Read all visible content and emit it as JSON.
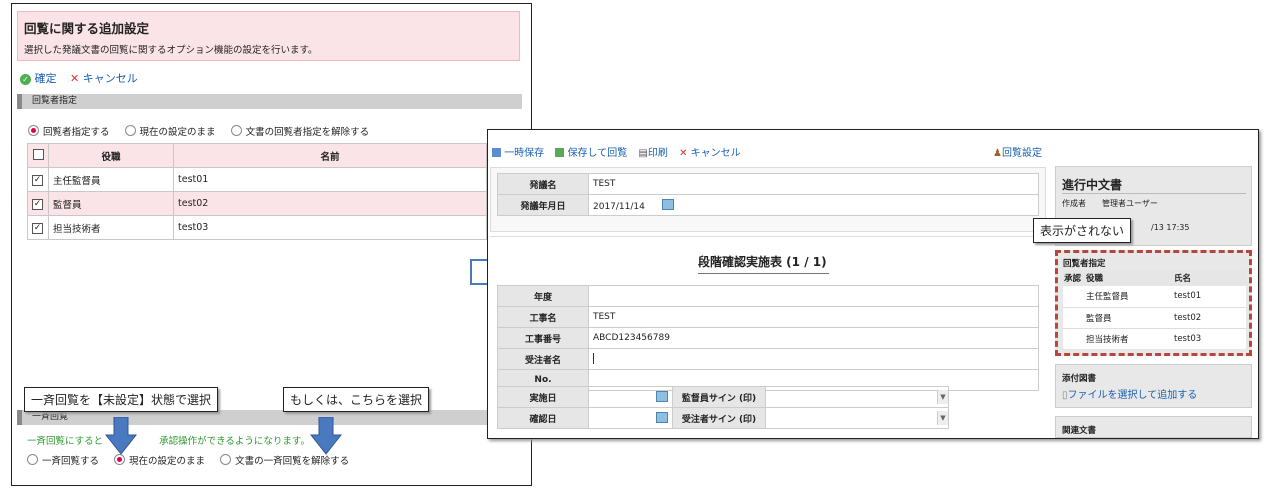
{
  "left": {
    "title": "回覧に関する追加設定",
    "description": "選択した発議文書の回覧に関するオプション機能の設定を行います。",
    "confirm": "確定",
    "cancel": "キャンセル",
    "section1": "回覧者指定",
    "radios1": [
      "回覧者指定する",
      "現在の設定のまま",
      "文書の回覧者指定を解除する"
    ],
    "table_headers": [
      "役職",
      "名前"
    ],
    "rows": [
      {
        "role": "主任監督員",
        "name": "test01"
      },
      {
        "role": "監督員",
        "name": "test02"
      },
      {
        "role": "担当技術者",
        "name": "test03"
      }
    ],
    "section2": "一斉回覧",
    "note_part1": "一斉回覧にすると",
    "note_part2": "承認操作ができるようになります。",
    "radios2": [
      "一斉回覧する",
      "現在の設定のまま",
      "文書の一斉回覧を解除する"
    ]
  },
  "callouts": {
    "a": "一斉回覧を【未設定】状態で選択",
    "b": "もしくは、こちらを選択",
    "c": "表示がされない"
  },
  "right": {
    "toolbar": [
      "一時保存",
      "保存して回覧",
      "印刷",
      "キャンセル"
    ],
    "settings_link": "回覧設定",
    "form_top": [
      {
        "label": "発議名",
        "value": "TEST"
      },
      {
        "label": "発議年月日",
        "value": "2017/11/14"
      }
    ],
    "doc_title": "段階確認実施表 (1 / 1)",
    "fields": [
      {
        "label": "年度",
        "value": ""
      },
      {
        "label": "工事名",
        "value": "TEST"
      },
      {
        "label": "工事番号",
        "value": "ABCD123456789"
      },
      {
        "label": "受注者名",
        "value": ""
      },
      {
        "label": "No.",
        "value": ""
      }
    ],
    "row_impl": {
      "label": "実施日",
      "label2": "監督員サイン (印)"
    },
    "row_conf": {
      "label": "確認日",
      "label2": "受注者サイン (印)"
    },
    "side": {
      "title": "進行中文書",
      "author_label": "作成者",
      "author_value": "管理者ユーザー",
      "time_fragment": "/13 17:35",
      "circ_title": "回覧者指定",
      "circ_headers": [
        "承認",
        "役職",
        "氏名"
      ],
      "circ_rows": [
        {
          "role": "主任監督員",
          "name": "test01"
        },
        {
          "role": "監督員",
          "name": "test02"
        },
        {
          "role": "担当技術者",
          "name": "test03"
        }
      ],
      "attach_title": "添付図書",
      "attach_link": "ファイルを選択して追加する",
      "related_title": "関連文書"
    }
  },
  "colors": {
    "accent_blue": "#1a5fb4",
    "pink": "#fbe4e8",
    "dash_red": "#b5473f",
    "arrow_blue": "#4a79c0"
  }
}
